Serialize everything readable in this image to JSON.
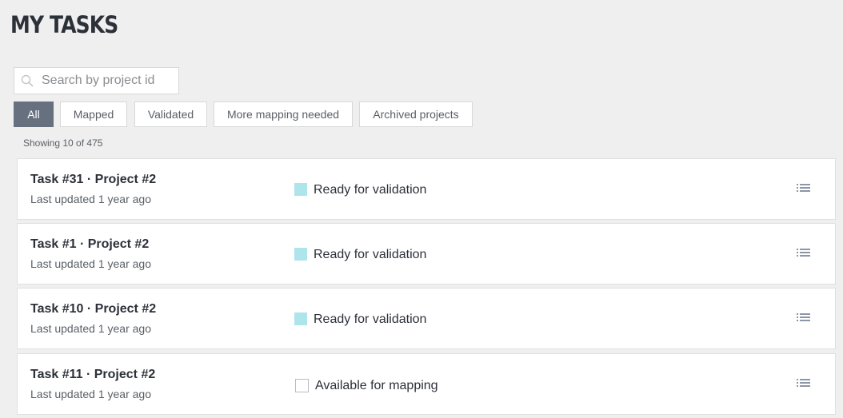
{
  "page": {
    "title": "MY TASKS"
  },
  "search": {
    "placeholder": "Search by project id",
    "value": ""
  },
  "filters": [
    {
      "label": "All",
      "active": true
    },
    {
      "label": "Mapped",
      "active": false
    },
    {
      "label": "Validated",
      "active": false
    },
    {
      "label": "More mapping needed",
      "active": false
    },
    {
      "label": "Archived projects",
      "active": false
    }
  ],
  "results": {
    "count_text": "Showing 10 of 475"
  },
  "colors": {
    "ready_for_validation": "#aee4ec",
    "available_for_mapping": "#ffffff",
    "active_filter": "#67707e"
  },
  "tasks": [
    {
      "title": "Task #31 · Project #2",
      "updated": "Last updated 1 year ago",
      "status": "Ready for validation",
      "status_key": "ready_for_validation",
      "icon": "list-icon"
    },
    {
      "title": "Task #1 · Project #2",
      "updated": "Last updated 1 year ago",
      "status": "Ready for validation",
      "status_key": "ready_for_validation",
      "icon": "list-icon"
    },
    {
      "title": "Task #10 · Project #2",
      "updated": "Last updated 1 year ago",
      "status": "Ready for validation",
      "status_key": "ready_for_validation",
      "icon": "list-icon"
    },
    {
      "title": "Task #11 · Project #2",
      "updated": "Last updated 1 year ago",
      "status": "Available for mapping",
      "status_key": "available_for_mapping",
      "icon": "list-icon"
    }
  ]
}
